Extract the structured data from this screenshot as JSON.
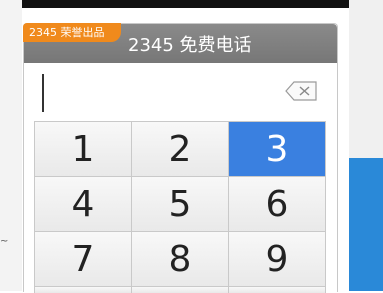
{
  "dialer": {
    "brand_badge": "2345 荣誉出品",
    "title": "2345 免费电话",
    "number_input_value": "",
    "keys": [
      {
        "label": "1",
        "active": false
      },
      {
        "label": "2",
        "active": false
      },
      {
        "label": "3",
        "active": true
      },
      {
        "label": "4",
        "active": false
      },
      {
        "label": "5",
        "active": false
      },
      {
        "label": "6",
        "active": false
      },
      {
        "label": "7",
        "active": false
      },
      {
        "label": "8",
        "active": false
      },
      {
        "label": "9",
        "active": false
      }
    ]
  },
  "colors": {
    "header_bg": "#808080",
    "brand_badge_bg": "#f08a1c",
    "active_key_bg": "#3a80e0"
  },
  "icons": {
    "clear": "backspace-icon"
  }
}
